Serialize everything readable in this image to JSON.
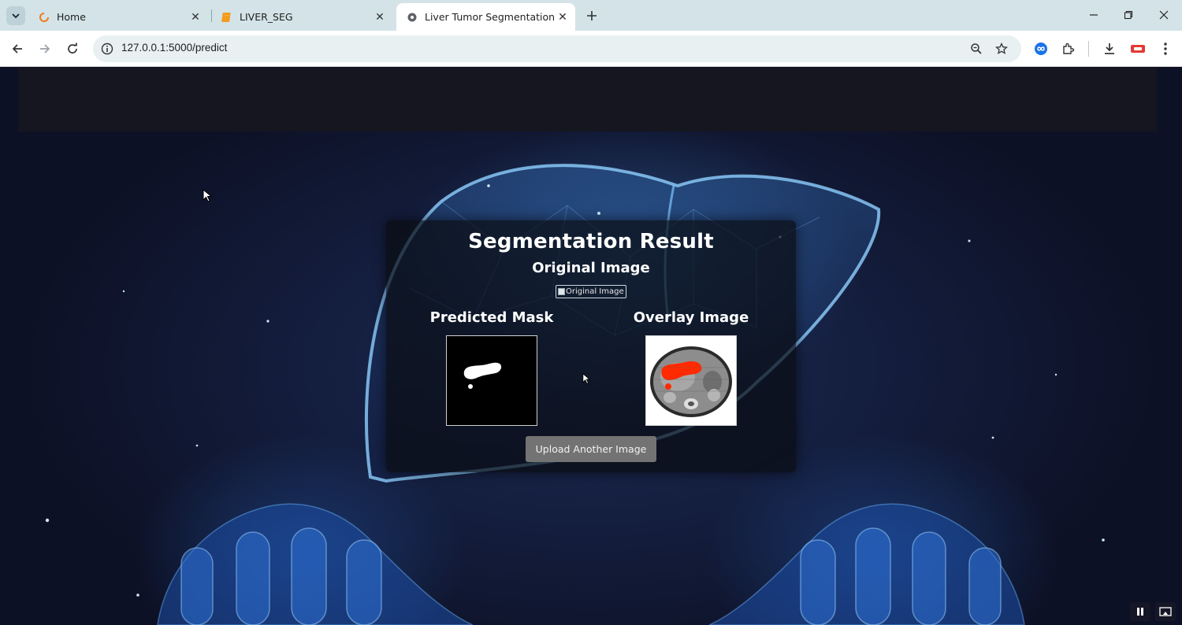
{
  "browser": {
    "tabs": [
      {
        "title": "Home",
        "active": false,
        "icon": "loading-ring-icon"
      },
      {
        "title": "LIVER_SEG",
        "active": false,
        "icon": "notebook-icon"
      },
      {
        "title": "Liver Tumor Segmentation",
        "active": true,
        "icon": "globe-icon"
      }
    ],
    "url": "127.0.0.1:5000/predict"
  },
  "result": {
    "title": "Segmentation Result",
    "original_heading": "Original Image",
    "original_alt": "Original Image",
    "mask_heading": "Predicted Mask",
    "overlay_heading": "Overlay Image",
    "upload_button": "Upload Another Image"
  },
  "colors": {
    "accent_tab_bar": "#d3e3e7",
    "overlay_tumor": "#ff2a00",
    "button": "#737373"
  }
}
